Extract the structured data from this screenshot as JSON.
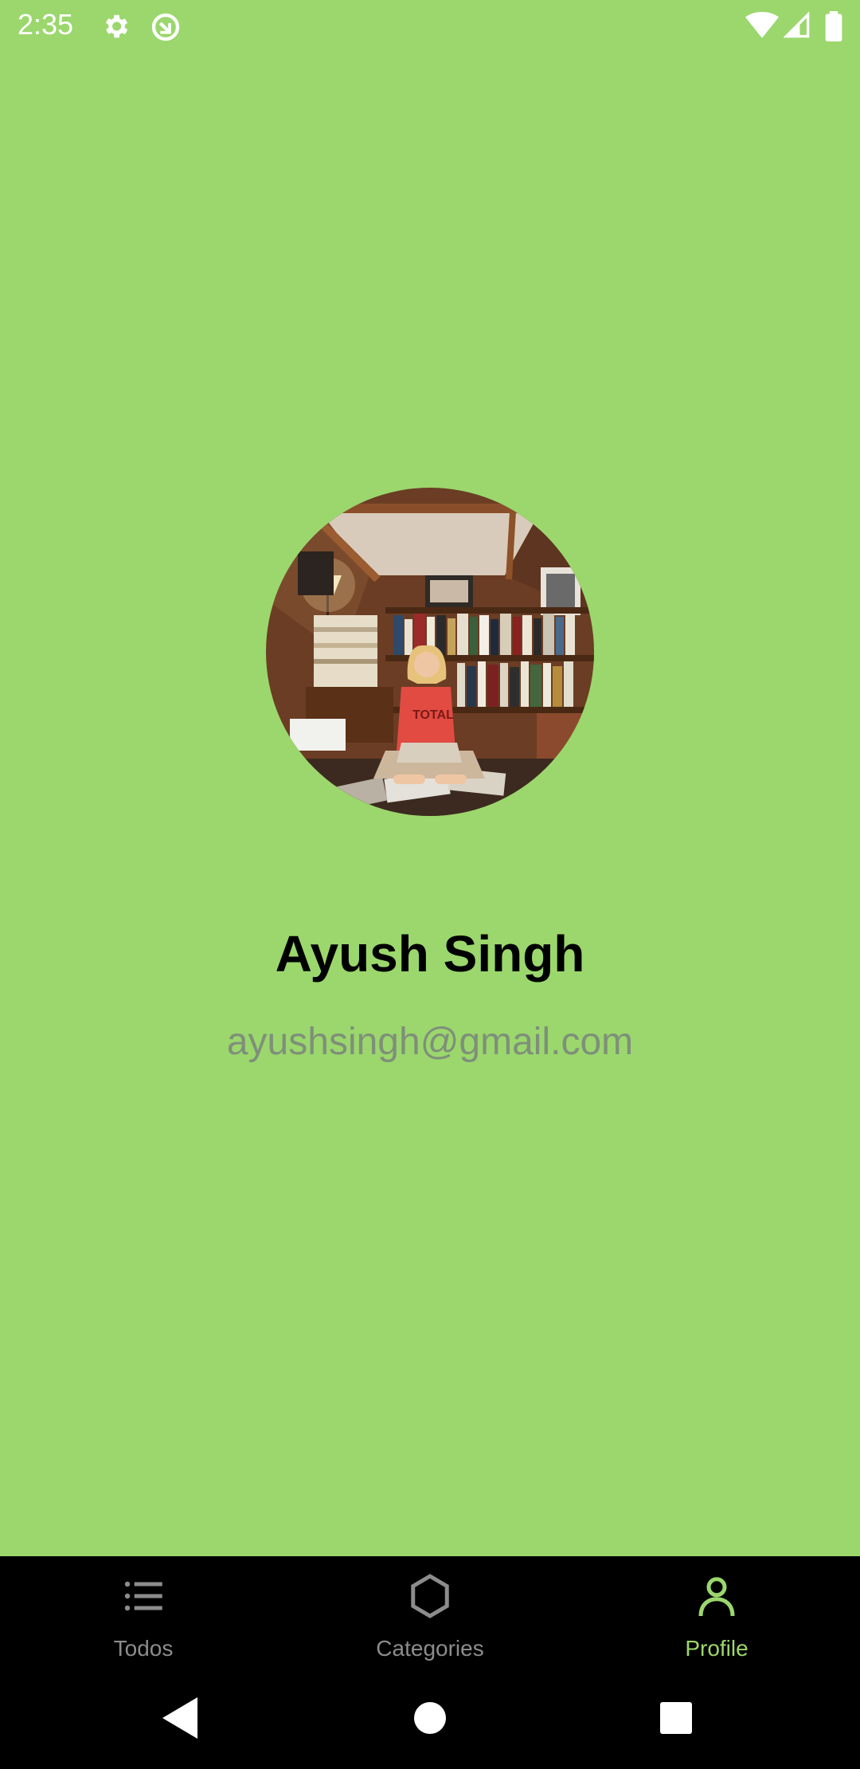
{
  "status_bar": {
    "time": "2:35",
    "left_icons": [
      "gear-icon",
      "sync-icon"
    ],
    "right_icons": [
      "wifi-icon",
      "cellular-icon",
      "battery-icon"
    ]
  },
  "profile": {
    "name": "Ayush Singh",
    "email": "ayushsingh@gmail.com",
    "avatar_icon": "profile-photo"
  },
  "bottom_nav": {
    "items": [
      {
        "label": "Todos",
        "icon": "list-icon",
        "active": false
      },
      {
        "label": "Categories",
        "icon": "hexagon-icon",
        "active": false
      },
      {
        "label": "Profile",
        "icon": "person-icon",
        "active": true
      }
    ]
  },
  "system_nav": {
    "buttons": [
      "back-icon",
      "home-icon",
      "recents-icon"
    ]
  },
  "colors": {
    "background": "#9bd76d",
    "accent": "#9bd76d",
    "nav_background": "#000000",
    "inactive": "#8c8c8c",
    "email": "#7f8f7a"
  }
}
